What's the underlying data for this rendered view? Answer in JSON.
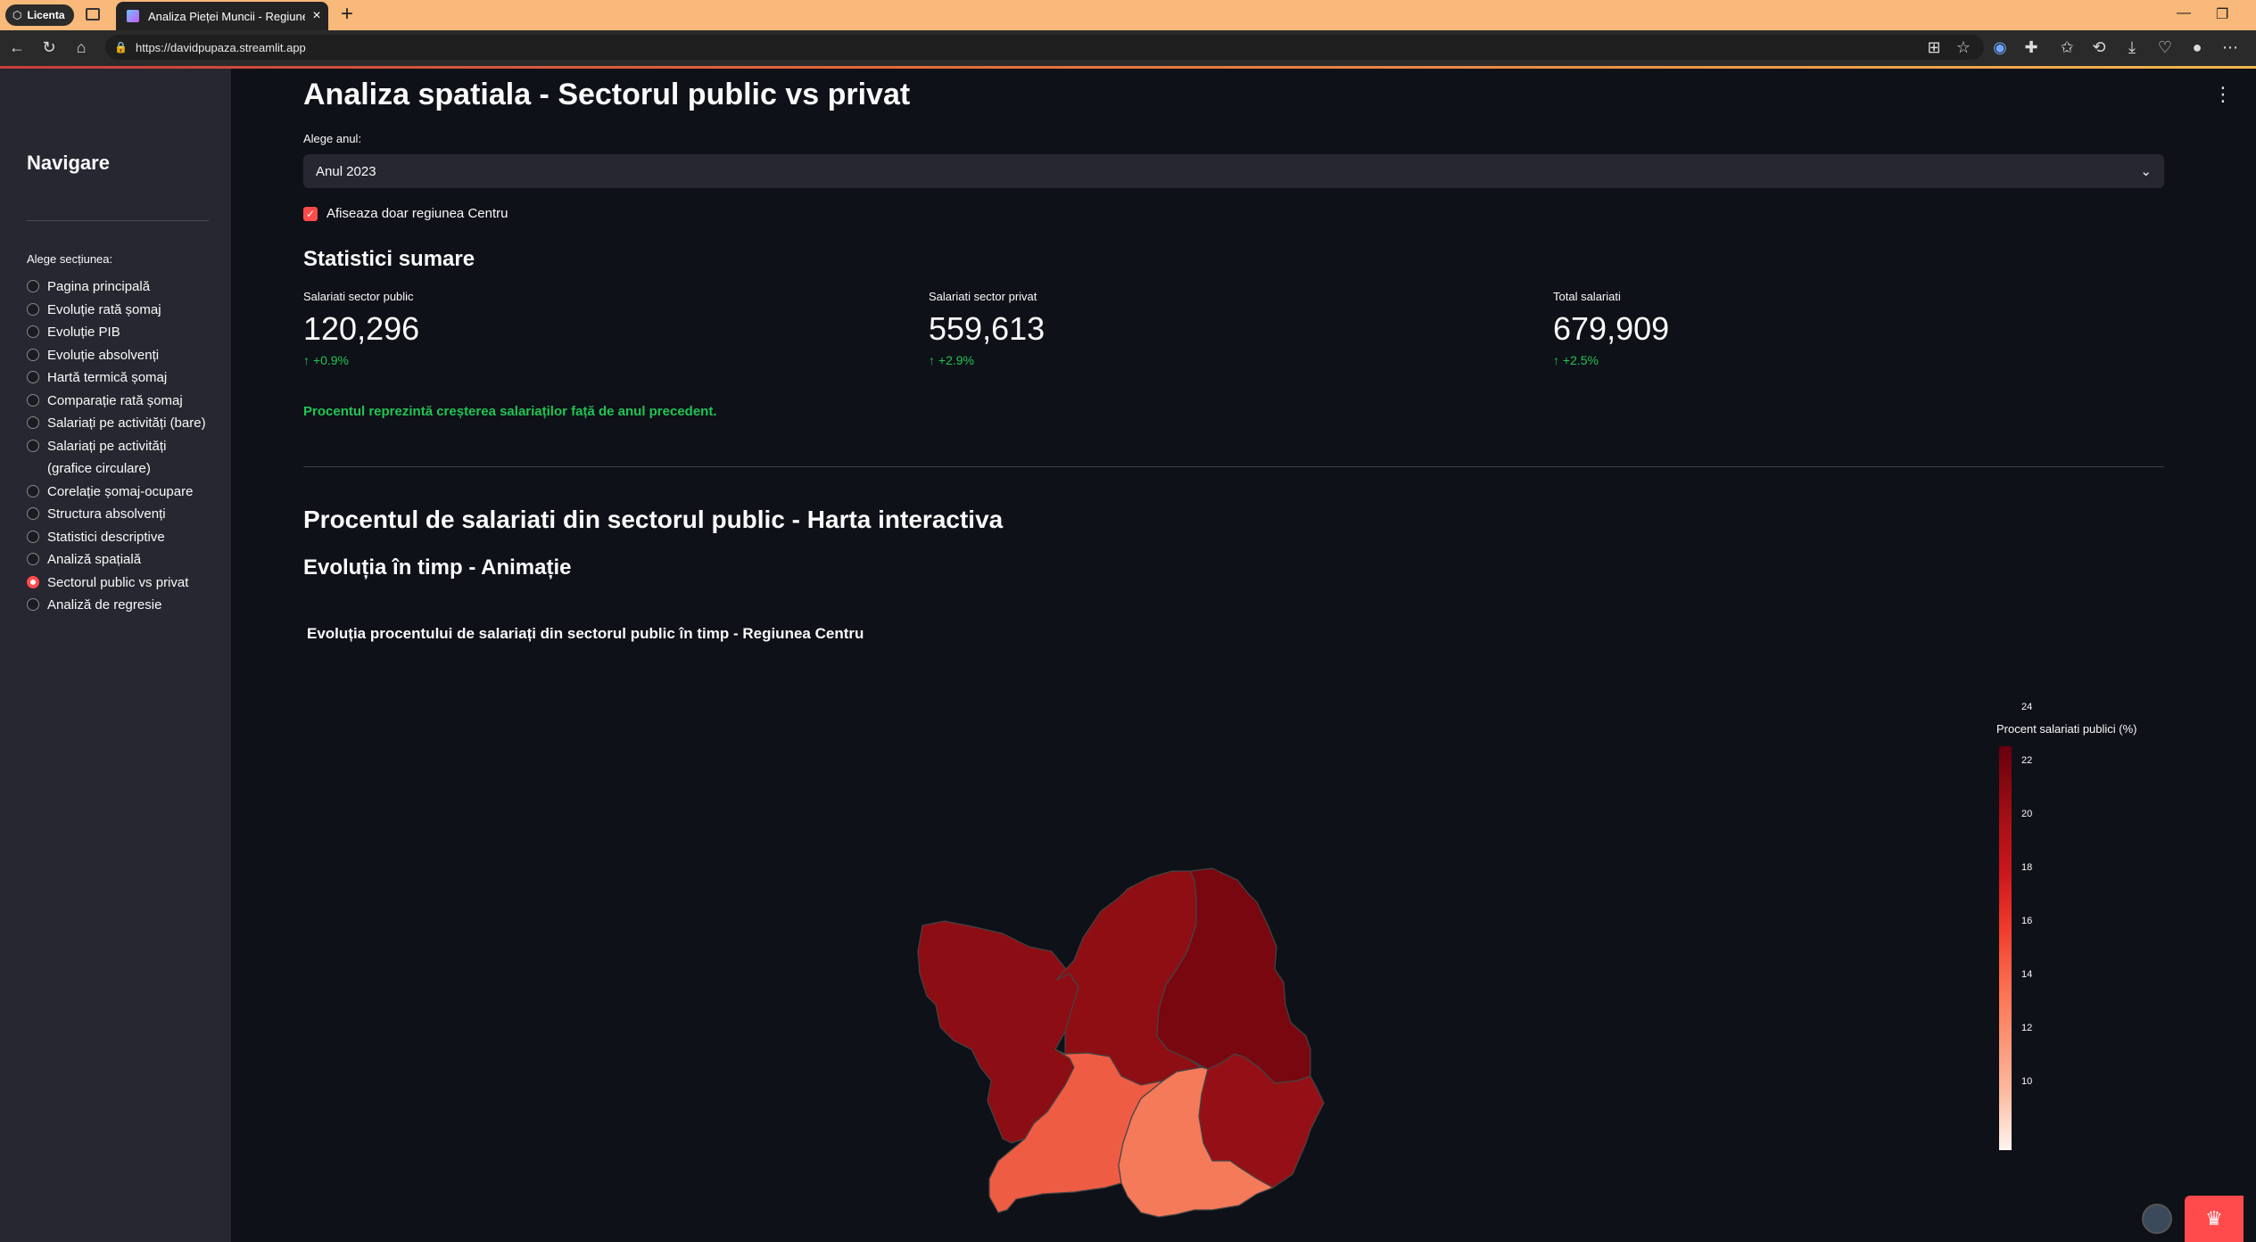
{
  "browser": {
    "profile_label": "Licenta",
    "tab_title": "Analiza Pieței Muncii - Regiunea C",
    "url": "https://davidpupaza.streamlit.app"
  },
  "sidebar": {
    "title": "Navigare",
    "section_label": "Alege secțiunea:",
    "items": [
      {
        "label": "Pagina principală",
        "selected": false
      },
      {
        "label": "Evoluție rată șomaj",
        "selected": false
      },
      {
        "label": "Evoluție PIB",
        "selected": false
      },
      {
        "label": "Evoluție absolvenți",
        "selected": false
      },
      {
        "label": "Hartă termică șomaj",
        "selected": false
      },
      {
        "label": "Comparație rată șomaj",
        "selected": false
      },
      {
        "label": "Salariați pe activități (bare)",
        "selected": false
      },
      {
        "label": "Salariați pe activități (grafice circulare)",
        "selected": false
      },
      {
        "label": "Corelație șomaj-ocupare",
        "selected": false
      },
      {
        "label": "Structura absolvenți",
        "selected": false
      },
      {
        "label": "Statistici descriptive",
        "selected": false
      },
      {
        "label": "Analiză spațială",
        "selected": false
      },
      {
        "label": "Sectorul public vs privat",
        "selected": true
      },
      {
        "label": "Analiză de regresie",
        "selected": false
      }
    ]
  },
  "main": {
    "title": "Analiza spatiala - Sectorul public vs privat",
    "year_label": "Alege anul:",
    "year_value": "Anul 2023",
    "checkbox_label": "Afiseaza doar regiunea Centru",
    "checkbox_checked": true,
    "summary_title": "Statistici sumare",
    "metrics": [
      {
        "label": "Salariati sector public",
        "value": "120,296",
        "delta": "+0.9%"
      },
      {
        "label": "Salariati sector privat",
        "value": "559,613",
        "delta": "+2.9%"
      },
      {
        "label": "Total salariati",
        "value": "679,909",
        "delta": "+2.5%"
      }
    ],
    "note": "Procentul reprezintă creșterea salariaților față de anul precedent.",
    "map_section_title": "Procentul de salariati din sectorul public - Harta interactiva",
    "animation_title": "Evoluția în timp - Animație",
    "chart_title": "Evoluția procentului de salariați din sectorul public în timp - Regiunea Centru"
  },
  "chart_data": {
    "type": "choropleth",
    "title": "Evoluția procentului de salariați din sectorul public în timp - Regiunea Centru",
    "colorbar_title": "Procent salariati publici (%)",
    "colorbar_ticks": [
      "24",
      "22",
      "20",
      "18",
      "16",
      "14",
      "12",
      "10"
    ],
    "range": [
      10,
      25
    ],
    "colorscale": "Reds",
    "regions": [
      {
        "id": "west",
        "value": 23,
        "color": "#8c0d13"
      },
      {
        "id": "north-center",
        "value": 23,
        "color": "#8e0e14"
      },
      {
        "id": "north-east",
        "value": 25,
        "color": "#780710"
      },
      {
        "id": "east",
        "value": 22.5,
        "color": "#951016"
      },
      {
        "id": "south-west",
        "value": 15,
        "color": "#ef5c44"
      },
      {
        "id": "south-east",
        "value": 14,
        "color": "#f47a5a"
      }
    ]
  },
  "colors": {
    "accent": "#ff4b4b",
    "positive": "#21c354",
    "background": "#0e1117",
    "sidebar": "#262730"
  }
}
